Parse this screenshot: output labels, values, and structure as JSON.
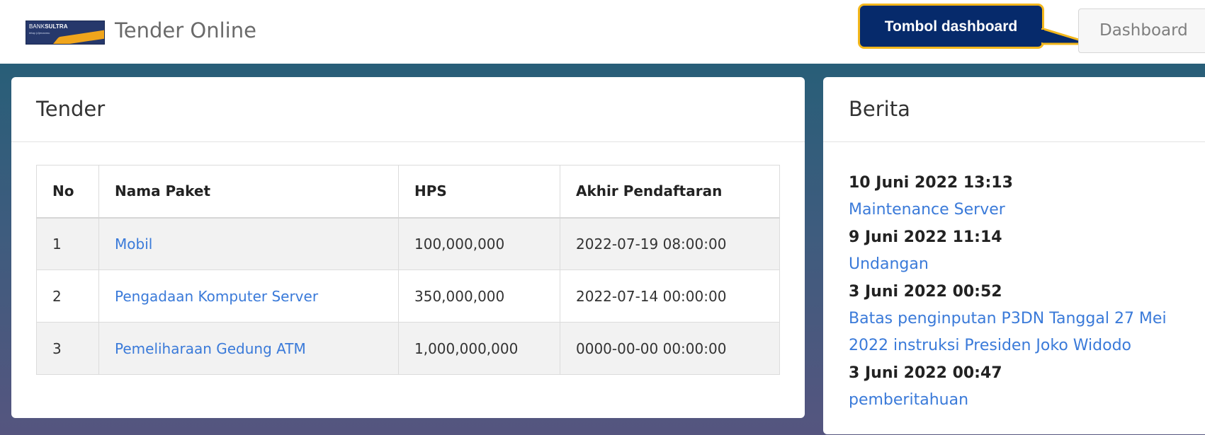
{
  "header": {
    "logo": {
      "brand_prefix": "BANK",
      "brand_main": "SULTRA",
      "tagline": "tétap (d)enanmu"
    },
    "app_title": "Tender Online",
    "callout_text": "Tombol dashboard",
    "dashboard_button": "Dashboard"
  },
  "tender": {
    "title": "Tender",
    "columns": [
      "No",
      "Nama Paket",
      "HPS",
      "Akhir Pendaftaran"
    ],
    "rows": [
      {
        "no": "1",
        "nama": "Mobil",
        "hps": "100,000,000",
        "akhir": "2022-07-19 08:00:00"
      },
      {
        "no": "2",
        "nama": "Pengadaan Komputer Server",
        "hps": "350,000,000",
        "akhir": "2022-07-14 00:00:00"
      },
      {
        "no": "3",
        "nama": "Pemeliharaan Gedung ATM",
        "hps": "1,000,000,000",
        "akhir": "0000-00-00 00:00:00"
      }
    ]
  },
  "berita": {
    "title": "Berita",
    "items": [
      {
        "date": "10 Juni 2022 13:13",
        "title": "Maintenance Server"
      },
      {
        "date": "9 Juni 2022 11:14",
        "title": "Undangan"
      },
      {
        "date": "3 Juni 2022 00:52",
        "title": "Batas penginputan P3DN Tanggal 27 Mei 2022 instruksi Presiden Joko Widodo"
      },
      {
        "date": "3 Juni 2022 00:47",
        "title": "pemberitahuan"
      }
    ]
  },
  "colors": {
    "accent_link": "#3a7ad9",
    "callout_bg": "#062a6b",
    "callout_border": "#f3b71c",
    "logo_bg": "#26386b"
  }
}
